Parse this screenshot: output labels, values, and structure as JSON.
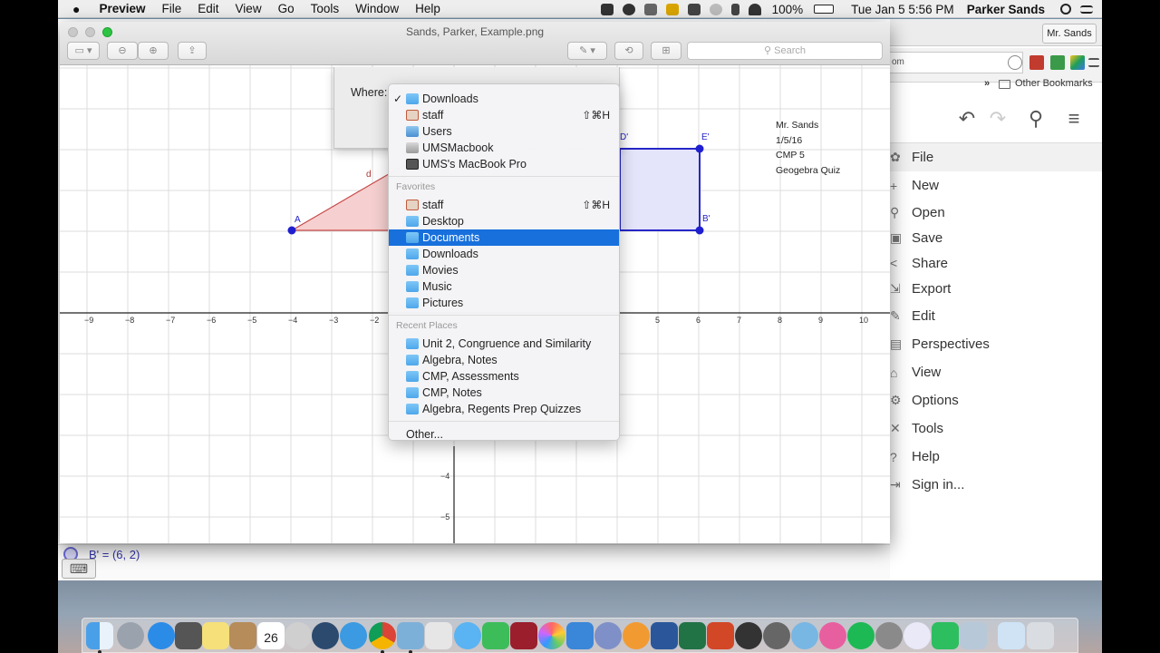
{
  "menubar": {
    "app": "Preview",
    "menus": [
      "File",
      "Edit",
      "View",
      "Go",
      "Tools",
      "Window",
      "Help"
    ],
    "battery": "100%",
    "clock": "Tue Jan 5  5:56 PM",
    "user": "Parker Sands"
  },
  "chrome": {
    "profile_button": "Mr. Sands",
    "address_fragment": "om",
    "bookmarks_overflow": "»",
    "other_bookmarks": "Other Bookmarks"
  },
  "geogebra": {
    "menu": [
      "File",
      "New",
      "Open",
      "Save",
      "Share",
      "Export",
      "Edit",
      "Perspectives",
      "View",
      "Options",
      "Tools",
      "Help",
      "Sign in..."
    ],
    "algebra_row": "B' = (6, 2)"
  },
  "preview": {
    "title": "Sands, Parker, Example.png",
    "search_placeholder": "Search",
    "notes": [
      "Mr. Sands",
      "1/5/16",
      "CMP 5",
      "Geogebra Quiz"
    ],
    "x_ticks": [
      -9,
      -8,
      -7,
      -6,
      -5,
      -4,
      -3,
      -2,
      5,
      6,
      7,
      8,
      9,
      10
    ],
    "y_ticks": [
      -4,
      -5
    ],
    "point_labels": {
      "A": "A",
      "d": "d",
      "D_prime": "D'",
      "E_prime": "E'",
      "B_prime": "B'"
    }
  },
  "export_sheet": {
    "where_label": "Where:",
    "selected": "Downloads",
    "top_items": [
      {
        "label": "Downloads",
        "icon": "downloads-folder",
        "checked": true
      },
      {
        "label": "staff",
        "icon": "home",
        "shortcut": "⇧⌘H"
      },
      {
        "label": "Users",
        "icon": "users-folder"
      },
      {
        "label": "UMSMacbook",
        "icon": "hard-drive"
      },
      {
        "label": "UMS's MacBook Pro",
        "icon": "laptop"
      }
    ],
    "favorites_header": "Favorites",
    "favorites": [
      {
        "label": "staff",
        "icon": "home",
        "shortcut": "⇧⌘H"
      },
      {
        "label": "Desktop",
        "icon": "folder"
      },
      {
        "label": "Documents",
        "icon": "folder",
        "highlighted": true
      },
      {
        "label": "Downloads",
        "icon": "downloads-folder"
      },
      {
        "label": "Movies",
        "icon": "folder"
      },
      {
        "label": "Music",
        "icon": "folder"
      },
      {
        "label": "Pictures",
        "icon": "folder"
      }
    ],
    "recent_header": "Recent Places",
    "recent": [
      {
        "label": "Unit 2, Congruence and Similarity",
        "icon": "folder"
      },
      {
        "label": "Algebra, Notes",
        "icon": "folder"
      },
      {
        "label": "CMP, Assessments",
        "icon": "folder"
      },
      {
        "label": "CMP, Notes",
        "icon": "folder"
      },
      {
        "label": "Algebra, Regents Prep Quizzes",
        "icon": "folder"
      }
    ],
    "other": "Other..."
  },
  "dock": {
    "calendar_day": "26"
  },
  "colors": {
    "menu_highlight": "#1770dc",
    "triangle_fill": "#f6d0d0",
    "triangle_stroke": "#c84a4a",
    "rect_fill": "#e4e4fb",
    "rect_stroke": "#2626c8",
    "point": "#1f1fd0"
  }
}
